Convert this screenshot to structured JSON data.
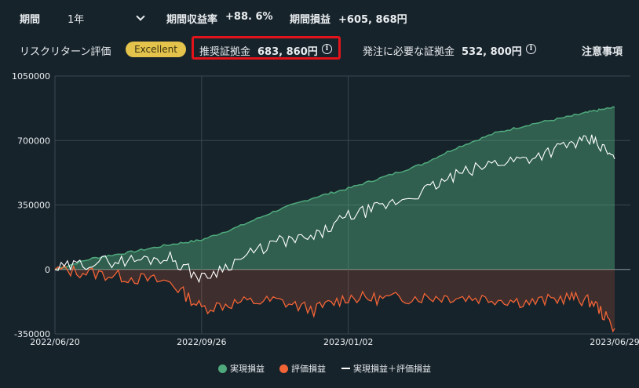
{
  "header": {
    "period_label": "期間",
    "period_value": "1年",
    "return_label": "期間収益率",
    "return_value": "+88. 6%",
    "profit_label": "期間損益",
    "profit_value": "+605, 868円"
  },
  "risk": {
    "label": "リスクリターン評価",
    "badge": "Excellent",
    "recommended_label": "推奨証拠金",
    "recommended_value": "683, 860円",
    "required_label": "発注に必要な証拠金",
    "required_value": "532, 800円",
    "notes_link": "注意事項"
  },
  "legend": {
    "realized": "実現損益",
    "unrealized": "評価損益",
    "total": "実現損益＋評価損益"
  },
  "colors": {
    "realized": "#4fa97c",
    "unrealized": "#f26436",
    "total": "#ffffff",
    "highlight": "#e0141a",
    "badge": "#e3c34b"
  },
  "chart_data": {
    "type": "area",
    "y_ticks": [
      "1050000",
      "700000",
      "350000",
      "0",
      "-350000"
    ],
    "x_ticks": [
      "2022/06/20",
      "2022/09/26",
      "2023/01/02",
      "2023/06/29"
    ],
    "x_dates": [
      "2022-06-20",
      "2022-07-15",
      "2022-08-10",
      "2022-09-05",
      "2022-09-26",
      "2022-10-20",
      "2022-11-15",
      "2022-12-10",
      "2023-01-02",
      "2023-01-25",
      "2023-02-20",
      "2023-03-15",
      "2023-04-10",
      "2023-05-05",
      "2023-05-30",
      "2023-06-15",
      "2023-06-29"
    ],
    "ylim": [
      -350000,
      1050000
    ],
    "grid": true,
    "legend_position": "bottom",
    "series": [
      {
        "name": "実現損益",
        "values": [
          0,
          60000,
          95000,
          135000,
          160000,
          230000,
          320000,
          390000,
          440000,
          500000,
          570000,
          660000,
          740000,
          790000,
          830000,
          860000,
          880000
        ]
      },
      {
        "name": "評価損益",
        "values": [
          0,
          -20000,
          -45000,
          -70000,
          -210000,
          -180000,
          -170000,
          -220000,
          -150000,
          -160000,
          -150000,
          -150000,
          -160000,
          -180000,
          -150000,
          -180000,
          -320000
        ]
      },
      {
        "name": "実現損益＋評価損益",
        "values": [
          0,
          40000,
          50000,
          65000,
          -50000,
          50000,
          150000,
          170000,
          290000,
          340000,
          420000,
          510000,
          580000,
          610000,
          680000,
          700000,
          600000
        ]
      }
    ]
  }
}
